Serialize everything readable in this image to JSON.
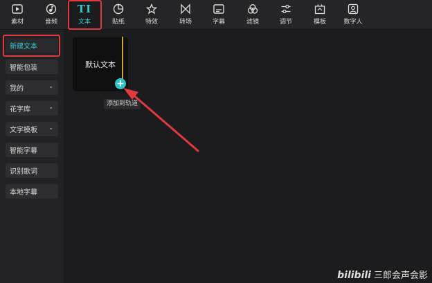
{
  "toolbar": {
    "items": [
      {
        "label": "素材",
        "icon": "media-icon"
      },
      {
        "label": "音频",
        "icon": "audio-icon"
      },
      {
        "label": "文本",
        "icon": "text-icon",
        "active": true
      },
      {
        "label": "贴纸",
        "icon": "sticker-icon"
      },
      {
        "label": "特效",
        "icon": "effects-icon"
      },
      {
        "label": "转场",
        "icon": "transition-icon"
      },
      {
        "label": "字幕",
        "icon": "subtitle-icon"
      },
      {
        "label": "滤镜",
        "icon": "filter-icon"
      },
      {
        "label": "调节",
        "icon": "adjust-icon"
      },
      {
        "label": "模板",
        "icon": "template-icon"
      },
      {
        "label": "数字人",
        "icon": "digital-human-icon"
      }
    ],
    "active_icon_text": "TI"
  },
  "sidebar": {
    "items": [
      {
        "label": "新建文本",
        "active": true
      },
      {
        "label": "智能包装"
      },
      {
        "label": "我的",
        "chevron": true
      },
      {
        "label": "花字库",
        "chevron": true
      },
      {
        "label": "文字模板",
        "chevron": true
      },
      {
        "label": "智能字幕"
      },
      {
        "label": "识别歌词"
      },
      {
        "label": "本地字幕"
      }
    ]
  },
  "main": {
    "card_text": "默认文本",
    "add_symbol": "+",
    "tooltip": "添加到轨道"
  },
  "watermark": {
    "logo": "bilibili",
    "text": "三郎会声会影"
  },
  "colors": {
    "accent": "#34c8cf",
    "highlight": "#e0393e"
  }
}
